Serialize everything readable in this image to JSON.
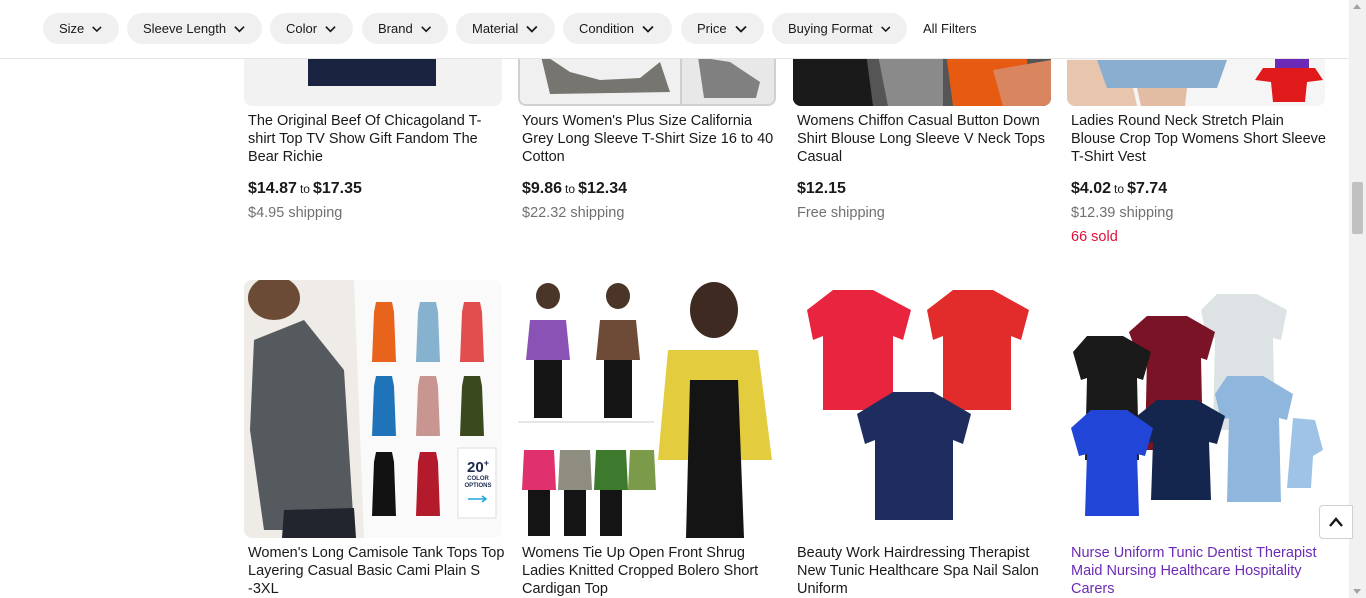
{
  "filters": {
    "pills": [
      {
        "label": "Size"
      },
      {
        "label": "Sleeve Length"
      },
      {
        "label": "Color"
      },
      {
        "label": "Brand"
      },
      {
        "label": "Material"
      },
      {
        "label": "Condition"
      },
      {
        "label": "Price"
      },
      {
        "label": "Buying Format"
      }
    ],
    "all_filters_label": "All Filters"
  },
  "listings": [
    {
      "title": "The Original Beef Of Chicagoland T-shirt Top TV Show Gift Fandom The Bear Richie",
      "price_low": "$14.87",
      "price_to": "to",
      "price_high": "$17.35",
      "shipping": "$4.95 shipping"
    },
    {
      "title": "Yours Women's Plus Size California Grey Long Sleeve T-Shirt Size 16 to 40 Cotton",
      "price_low": "$9.86",
      "price_to": "to",
      "price_high": "$12.34",
      "shipping": "$22.32 shipping"
    },
    {
      "title": "Womens Chiffon Casual Button Down Shirt Blouse Long Sleeve V Neck Tops Casual",
      "price": "$12.15",
      "shipping": "Free shipping"
    },
    {
      "title": "Ladies Round Neck Stretch Plain Blouse Crop Top Womens Short Sleeve T-Shirt Vest",
      "price_low": "$4.02",
      "price_to": "to",
      "price_high": "$7.74",
      "shipping": "$12.39 shipping",
      "sold": "66 sold"
    },
    {
      "title": "Women's Long Camisole Tank Tops Top Layering Casual Basic Cami Plain S -3XL",
      "badge_number": "20",
      "badge_plus": "+",
      "badge_text_1": "COLOR",
      "badge_text_2": "OPTIONS"
    },
    {
      "title": "Womens Tie Up Open Front Shrug Ladies Knitted Cropped Bolero Short Cardigan Top"
    },
    {
      "title": "Beauty Work Hairdressing Therapist New Tunic Healthcare Spa Nail Salon Uniform"
    },
    {
      "title": "Nurse Uniform Tunic Dentist Therapist Maid Nursing Healthcare Hospitality Carers"
    }
  ],
  "colors": {
    "visited_link": "#6b2ab5",
    "sold": "#e0103a",
    "shipping": "#707070"
  }
}
